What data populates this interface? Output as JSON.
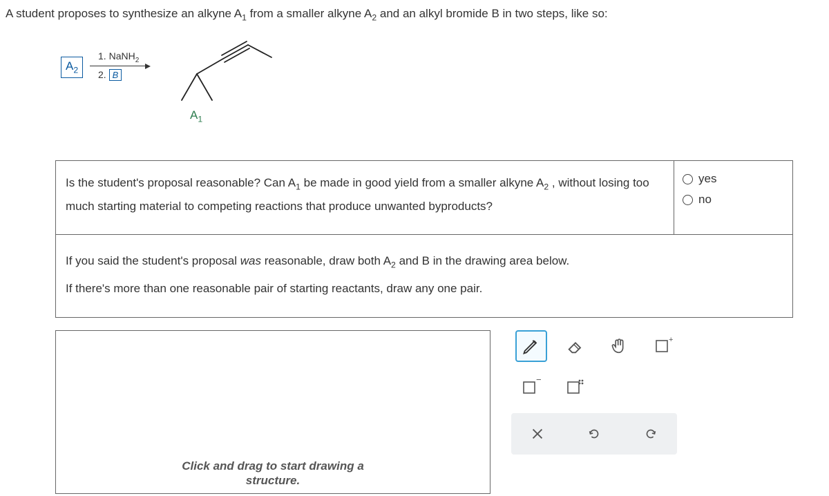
{
  "prompt": {
    "pre": "A student proposes to synthesize an alkyne A",
    "sub1": "1",
    "mid": " from a smaller alkyne A",
    "sub2": "2",
    "post": " and an alkyl bromide B in two steps, like so:"
  },
  "scheme": {
    "a2": "A",
    "a2_sub": "2",
    "reagent1_num": "1. ",
    "reagent1": "NaNH",
    "reagent1_sub": "2",
    "reagent2_num": "2. ",
    "reagent2_box": "B",
    "a1": "A",
    "a1_sub": "1"
  },
  "question": {
    "line1a": "Is the student's proposal reasonable? Can A",
    "line1a_sub": "1",
    "line1b": " be made in good yield from a smaller alkyne A",
    "line1b_sub": "2",
    "line1c": " , without losing too",
    "line2": "much starting material to competing reactions that produce unwanted byproducts?",
    "yes": "yes",
    "no": "no",
    "part2a": "If you said the student's proposal ",
    "part2_was": "was",
    "part2b": " reasonable, draw both A",
    "part2b_sub": "2",
    "part2c": " and B in the drawing area below.",
    "part3": "If there's more than one reasonable pair of starting reactants, draw any one pair."
  },
  "canvas": {
    "hint_l1": "Click and drag to start drawing a",
    "hint_l2": "structure."
  },
  "tools": {
    "pencil": "pencil-icon",
    "eraser": "eraser-icon",
    "hand": "hand-icon",
    "marquee_plus": "marquee-plus-icon",
    "marquee_minus": "marquee-minus-icon",
    "marquee_dots": "marquee-dots-icon",
    "clear": "clear-icon",
    "undo": "undo-icon",
    "redo": "redo-icon"
  }
}
